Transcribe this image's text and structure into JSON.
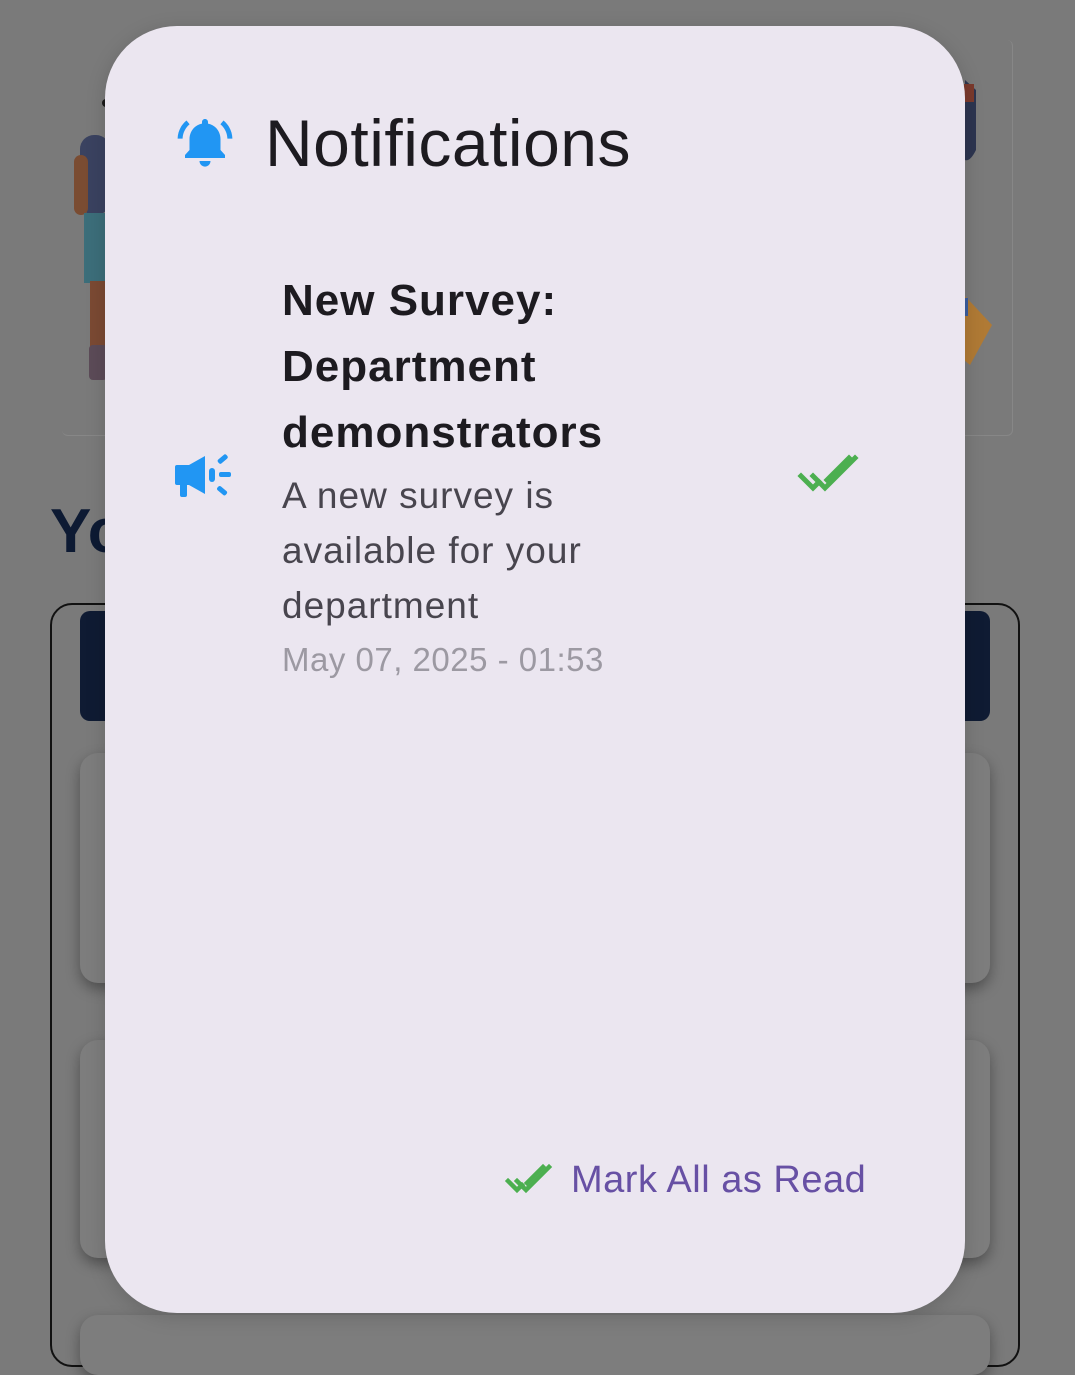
{
  "dialog": {
    "title": "Notifications",
    "icon": "bell-icon",
    "accent_color": "#2196f3"
  },
  "notifications": [
    {
      "icon": "megaphone-icon",
      "title": "New Survey: Department demonstrators",
      "body": "A new survey is available for your department",
      "time": "May 07, 2025 - 01:53",
      "read": true,
      "read_icon": "double-check-icon",
      "read_color": "#4caf50"
    }
  ],
  "actions": {
    "mark_all_read_label": "Mark All as Read",
    "mark_all_read_icon": "double-check-icon",
    "label_color": "#6750a4"
  },
  "background": {
    "heading_fragment": "Yo"
  }
}
